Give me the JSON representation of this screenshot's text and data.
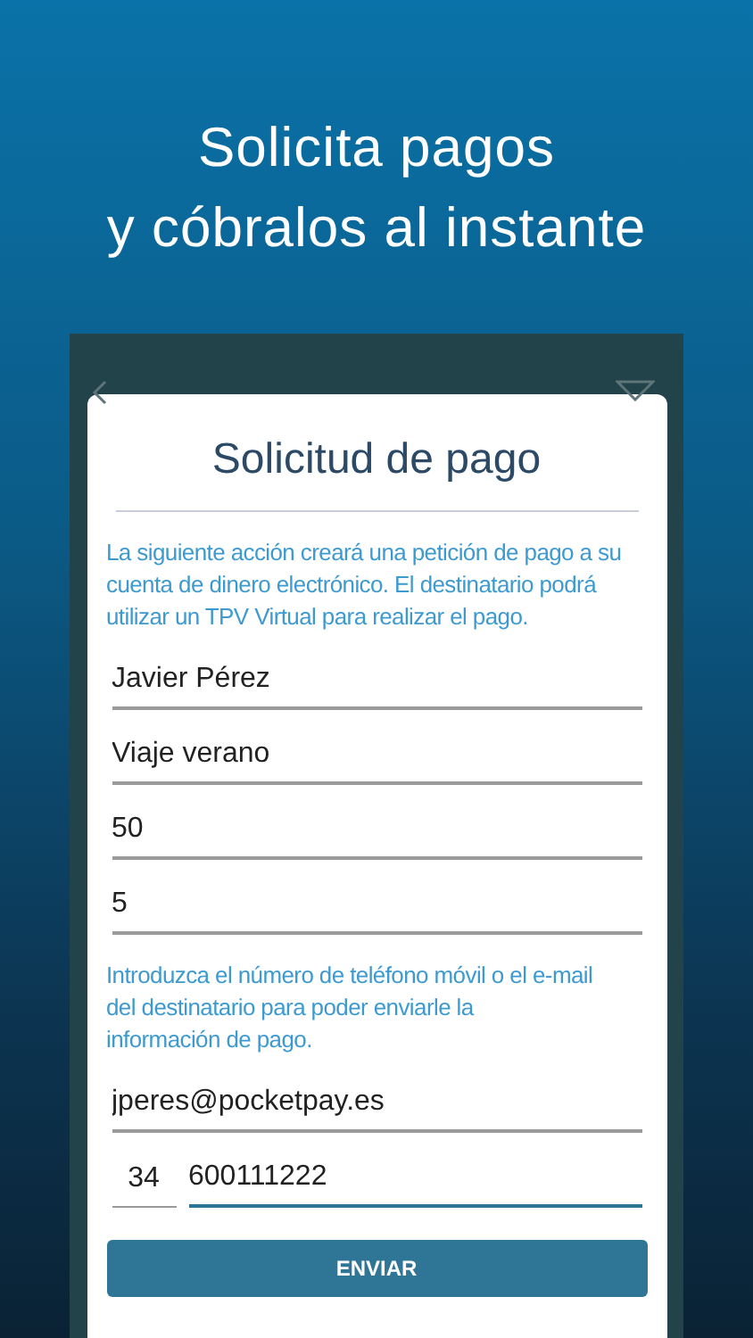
{
  "headline": [
    "Solicita pagos",
    "y cóbralos al instante"
  ],
  "dialog": {
    "title": "Solicitud de pago",
    "intro": "La siguiente acción creará una petición de pago a su cuenta de dinero electrónico. El destinatario podrá utilizar un TPV Virtual para realizar el pago.",
    "fields": [
      {
        "value": "Javier Pérez",
        "focused": false
      },
      {
        "value": "Viaje verano",
        "focused": false
      },
      {
        "value": "50",
        "focused": false
      },
      {
        "value": "5",
        "focused": false
      }
    ],
    "contact_hint": "Introduzca el número de teléfono móvil o el e-mail del destinatario para poder enviarle la información de pago.",
    "email": {
      "value": "jperes@pocketpay.es",
      "focused": false
    },
    "phone_prefix": {
      "value": "34",
      "focused": false
    },
    "phone_number": {
      "value": "600111222",
      "focused": true
    },
    "button": "ENVIAR"
  }
}
